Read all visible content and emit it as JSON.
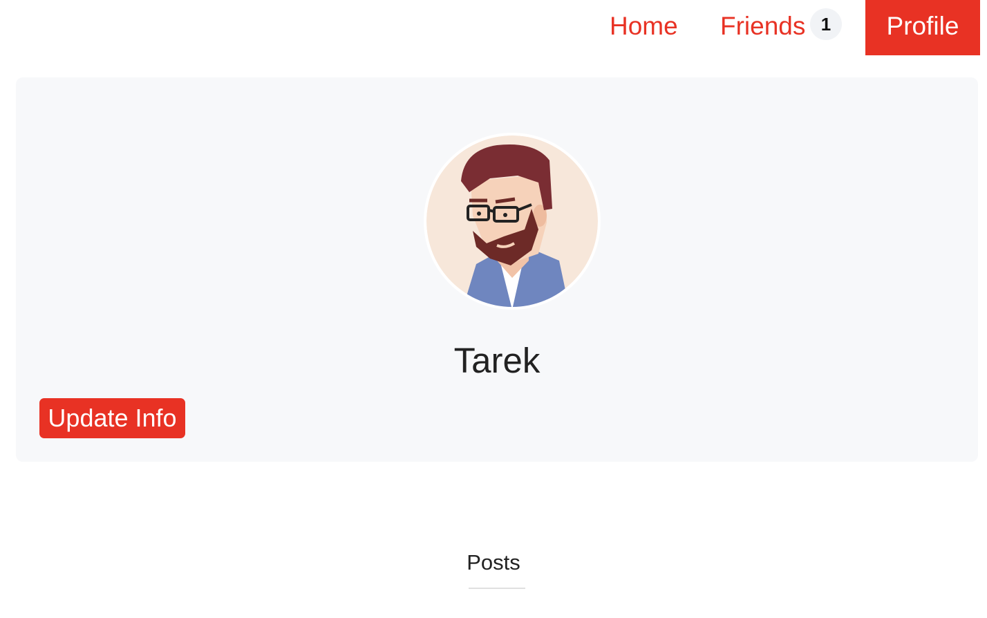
{
  "nav": {
    "home_label": "Home",
    "friends_label": "Friends",
    "friends_count": "1",
    "profile_label": "Profile"
  },
  "profile": {
    "name": "Tarek",
    "update_button_label": "Update Info",
    "avatar_icon": "bearded-man-avatar"
  },
  "posts": {
    "heading": "Posts"
  },
  "colors": {
    "accent": "#e83224",
    "card_bg": "#f7f8fa",
    "badge_bg": "#f1f3f6"
  }
}
